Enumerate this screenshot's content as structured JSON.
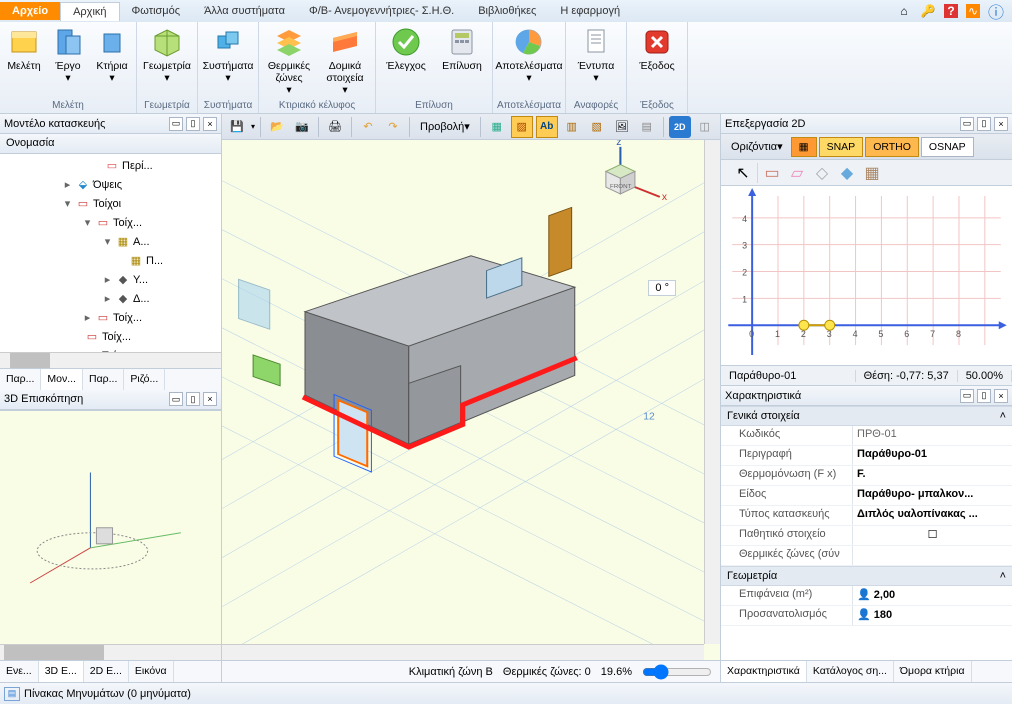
{
  "tabs": {
    "file": "Αρχείο",
    "active": "Αρχική",
    "t2": "Φωτισμός",
    "t3": "Άλλα συστήματα",
    "t4": "Φ/Β- Ανεμογεννήτριες- Σ.Η.Θ.",
    "t5": "Βιβλιοθήκες",
    "t6": "Η εφαρμογή"
  },
  "ribbon": {
    "g1": {
      "label": "Μελέτη",
      "b1": "Μελέτη",
      "b2": "Έργο",
      "b3": "Κτήρια"
    },
    "g2": {
      "label": "Γεωμετρία",
      "b1": "Γεωμετρία"
    },
    "g3": {
      "label": "Συστήματα",
      "b1": "Συστήματα"
    },
    "g4": {
      "label": "Κτιριακό κέλυφος",
      "b1": "Θερμικές ζώνες",
      "b2": "Δομικά στοιχεία"
    },
    "g5": {
      "label": "Επίλυση",
      "b1": "Έλεγχος",
      "b2": "Επίλυση"
    },
    "g6": {
      "label": "Αποτελέσματα",
      "b1": "Αποτελέσματα"
    },
    "g7": {
      "label": "Αναφορές",
      "b1": "Έντυπα"
    },
    "g8": {
      "label": "Έξοδος",
      "b1": "Έξοδος"
    }
  },
  "left": {
    "title": "Μοντέλο κατασκευής",
    "colhead": "Ονομασία",
    "nodes": [
      "Περί...",
      "Όψεις",
      "Τοίχοι",
      "Τοίχ...",
      "Α...",
      "Π...",
      "Υ...",
      "Δ...",
      "Τοίχ...",
      "Τοίχ...",
      "Τοίχ..."
    ],
    "tabs": [
      "Παρ...",
      "Μον...",
      "Παρ...",
      "Ριζό..."
    ],
    "preview_title": "3D Επισκόπηση",
    "ptabs": [
      "Ενε...",
      "3D Ε...",
      "2D Ε...",
      "Εικόνα"
    ]
  },
  "center": {
    "view_dd": "Προβολή",
    "temp": "0 °",
    "status": {
      "zone": "Κλιματική ζώνη Β",
      "tz": "Θερμικές ζώνες: 0",
      "pct": "19.6%"
    }
  },
  "right": {
    "title": "Επεξεργασία 2D",
    "horiz": "Οριζόντια",
    "snap": "SNAP",
    "ortho": "ORTHO",
    "osnap": "OSNAP",
    "obj": "Παράθυρο-01",
    "pos": "Θέση: -0,77: 5,37",
    "zoom": "50.00%",
    "props_title": "Χαρακτηριστικά",
    "pg1": "Γενικά στοιχεία",
    "p": {
      "code_k": "Κωδικός",
      "code_v": "ΠΡΘ-01",
      "desc_k": "Περιγραφή",
      "desc_v": "Παράθυρο-01",
      "th_k": "Θερμομόνωση (F x)",
      "th_v": "F.",
      "kind_k": "Είδος",
      "kind_v": "Παράθυρο- μπαλκον...",
      "type_k": "Τύπος κατασκευής",
      "type_v": "Διπλός υαλοπίνακας ...",
      "pass_k": "Παθητικό στοιχείο",
      "tz_k": "Θερμικές ζώνες (σύν"
    },
    "pg2": "Γεωμετρία",
    "p2": {
      "area_k": "Επιφάνεια (m²)",
      "area_v": "2,00",
      "orient_k": "Προσανατολισμός",
      "orient_v": "180"
    },
    "rtabs": [
      "Χαρακτηριστικά",
      "Κατάλογος ση...",
      "Όμορα κτήρια"
    ]
  },
  "bottom": {
    "msg": "Πίνακας Μηνυμάτων (0 μηνύματα)"
  },
  "chart_data": {
    "type": "scatter",
    "x": [
      2,
      3
    ],
    "y": [
      0,
      0
    ],
    "xlim": [
      -1,
      8
    ],
    "ylim": [
      -1,
      4
    ],
    "xticks": [
      0,
      1,
      2,
      3,
      4,
      5,
      6,
      7,
      8
    ],
    "yticks": [
      0,
      1,
      2,
      3,
      4
    ]
  }
}
